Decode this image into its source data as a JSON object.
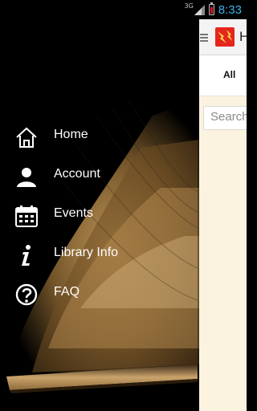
{
  "status_bar": {
    "network": "3G",
    "time": "8:33",
    "battery_level": 0.65
  },
  "app": {
    "title_partial": "H",
    "tab_all": "All",
    "search_placeholder": "Search"
  },
  "drawer": {
    "menu": [
      {
        "label": "Home",
        "icon": "home-icon"
      },
      {
        "label": "Account",
        "icon": "account-icon"
      },
      {
        "label": "Events",
        "icon": "calendar-icon"
      },
      {
        "label": "Library Info",
        "icon": "info-icon"
      },
      {
        "label": "FAQ",
        "icon": "help-icon"
      }
    ]
  },
  "colors": {
    "time": "#3ab0e8",
    "content_bg": "#fbf3df",
    "app_logo": "#e4261c"
  }
}
